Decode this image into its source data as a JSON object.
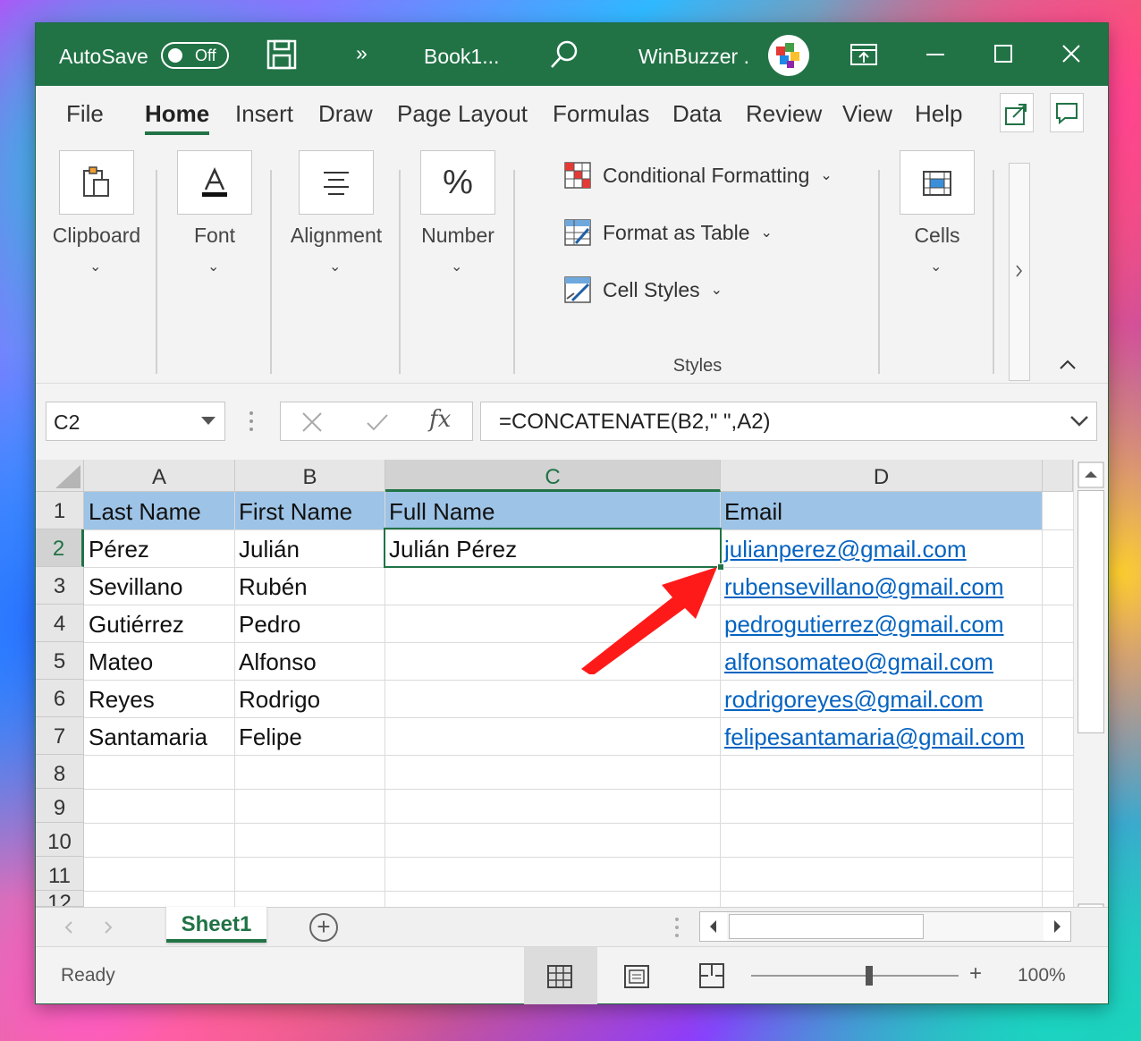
{
  "titlebar": {
    "autosave_label": "AutoSave",
    "toggle_state": "Off",
    "overflow_glyph": "»",
    "filename": "Book1...",
    "account": "WinBuzzer ."
  },
  "tabs": [
    "File",
    "Home",
    "Insert",
    "Draw",
    "Page Layout",
    "Formulas",
    "Data",
    "Review",
    "View",
    "Help"
  ],
  "ribbon": {
    "clipboard": "Clipboard",
    "font": "Font",
    "alignment": "Alignment",
    "number": "Number",
    "conditional_formatting": "Conditional Formatting",
    "format_as_table": "Format as Table",
    "cell_styles": "Cell Styles",
    "styles_group": "Styles",
    "cells": "Cells",
    "chevron": "⌄"
  },
  "formula_bar": {
    "name_box": "C2",
    "fx_label": "fx",
    "formula": "=CONCATENATE(B2,\" \",A2)"
  },
  "grid": {
    "columns": [
      "A",
      "B",
      "C",
      "D"
    ],
    "rows": [
      "1",
      "2",
      "3",
      "4",
      "5",
      "6",
      "7",
      "8",
      "9",
      "10",
      "11",
      "12"
    ],
    "headers": [
      "Last Name",
      "First Name",
      "Full Name",
      "Email"
    ],
    "data": [
      {
        "last": "Pérez",
        "first": "Julián",
        "full": "Julián Pérez",
        "email": "julianperez@gmail.com"
      },
      {
        "last": "Sevillano",
        "first": "Rubén",
        "full": "",
        "email": "rubensevillano@gmail.com"
      },
      {
        "last": "Gutiérrez",
        "first": "Pedro",
        "full": "",
        "email": "pedrogutierrez@gmail.com"
      },
      {
        "last": "Mateo",
        "first": "Alfonso",
        "full": "",
        "email": "alfonsomateo@gmail.com"
      },
      {
        "last": "Reyes",
        "first": "Rodrigo",
        "full": "",
        "email": "rodrigoreyes@gmail.com"
      },
      {
        "last": "Santamaria",
        "first": "Felipe",
        "full": "",
        "email": "felipesantamaria@gmail.com"
      }
    ]
  },
  "sheets": {
    "active": "Sheet1",
    "add_glyph": "+"
  },
  "status": {
    "ready": "Ready",
    "zoom": "100%"
  },
  "colors": {
    "excel_green": "#217346",
    "header_fill": "#9dc3e6",
    "link": "#0563c1",
    "arrow": "#ff1a1a"
  }
}
